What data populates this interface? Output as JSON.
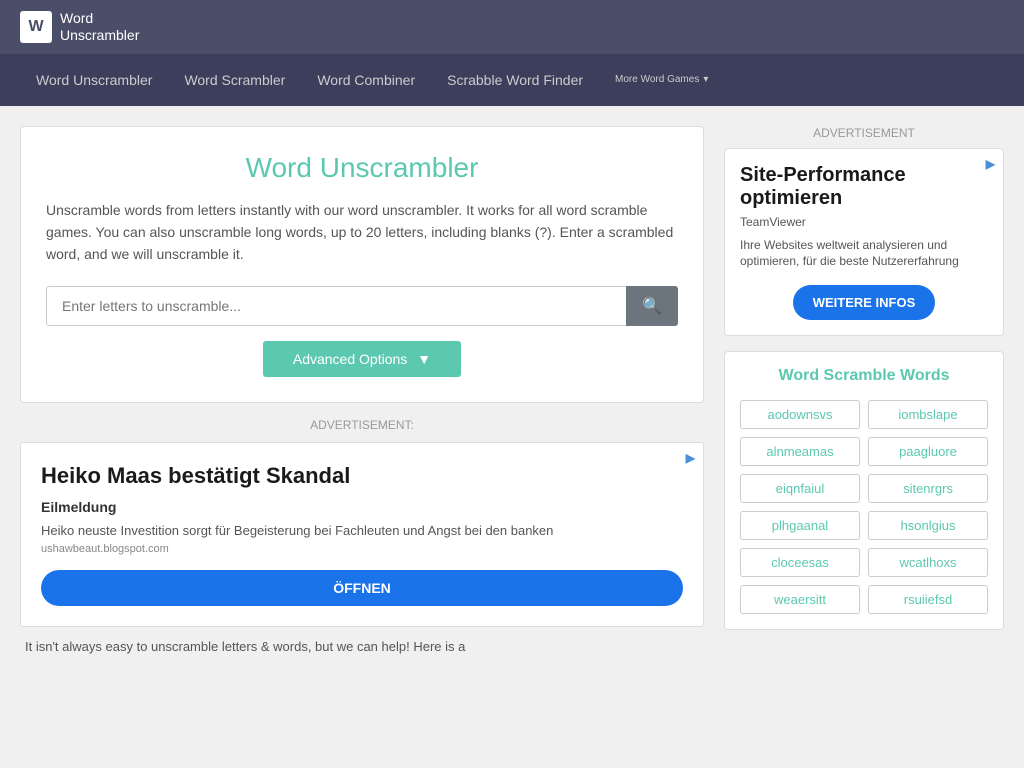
{
  "header": {
    "logo_letter": "W",
    "logo_line1": "Word",
    "logo_line2": "Unscrambler",
    "nav_items": [
      {
        "label": "Word Unscrambler",
        "href": "#"
      },
      {
        "label": "Word Scrambler",
        "href": "#"
      },
      {
        "label": "Word Combiner",
        "href": "#"
      },
      {
        "label": "Scrabble Word Finder",
        "href": "#"
      },
      {
        "label": "More Word Games",
        "href": "#"
      }
    ]
  },
  "main": {
    "title": "Word Unscrambler",
    "description": "Unscramble words from letters instantly with our word unscrambler. It works for all word scramble games. You can also unscramble long words, up to 20 letters, including blanks (?). Enter a scrambled word, and we will unscramble it.",
    "search_placeholder": "Enter letters to unscramble...",
    "search_icon": "🔍",
    "advanced_btn_label": "Advanced Options",
    "advanced_btn_arrow": "▼",
    "ad_label": "ADVERTISEMENT:",
    "ad": {
      "icon": "▶",
      "title": "Heiko Maas bestätigt Skandal",
      "subtitle": "Eilmeldung",
      "text": "Heiko neuste Investition sorgt für Begeisterung bei Fachleuten und Angst bei den banken",
      "url": "ushawbeaut.blogspot.com",
      "cta": "ÖFFNEN"
    },
    "bottom_text": "It isn't always easy to unscramble letters & words, but we can help! Here is a"
  },
  "sidebar": {
    "ad_label": "ADVERTISEMENT",
    "ad": {
      "icon": "▶",
      "title": "Site-Performance optimieren",
      "brand": "TeamViewer",
      "desc": "Ihre Websites weltweit analysieren und optimieren, für die beste Nutzererfahrung",
      "cta": "WEITERE INFOS"
    },
    "word_scramble_title": "Word Scramble Words",
    "words": [
      "aodownsvs",
      "iombslape",
      "alnmeamas",
      "paagluore",
      "eiqnfaiul",
      "sitenrgrs",
      "plhgaanal",
      "hsonlgius",
      "cloceesas",
      "wcatlhoxs",
      "weaersitt",
      "rsuiiefsd"
    ]
  }
}
